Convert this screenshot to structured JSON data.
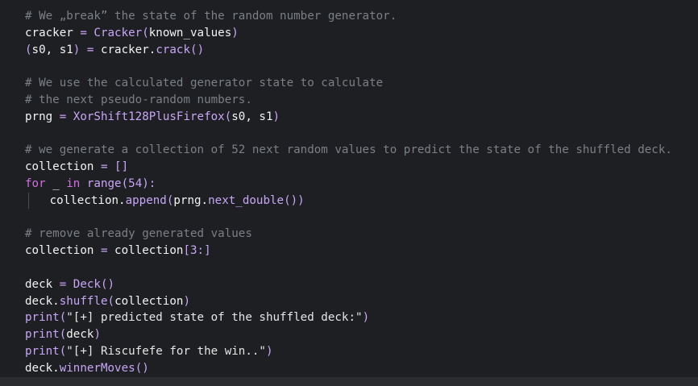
{
  "colors": {
    "background": "#1e1f22",
    "comment": "#7b7f86",
    "keyword": "#cf6fe0",
    "function": "#c8a6f7",
    "text": "#e6e6e6"
  },
  "code": {
    "lines": [
      {
        "tokens": [
          {
            "t": "comment",
            "v": "# We „break” the state of the random number generator."
          }
        ]
      },
      {
        "tokens": [
          {
            "t": "ident",
            "v": "cracker"
          },
          {
            "t": "op",
            "v": " = "
          },
          {
            "t": "fn",
            "v": "Cracker"
          },
          {
            "t": "op",
            "v": "("
          },
          {
            "t": "ident",
            "v": "known_values"
          },
          {
            "t": "op",
            "v": ")"
          }
        ]
      },
      {
        "tokens": [
          {
            "t": "op",
            "v": "("
          },
          {
            "t": "ident",
            "v": "s0, s1"
          },
          {
            "t": "op",
            "v": ")"
          },
          {
            "t": "op",
            "v": " = "
          },
          {
            "t": "ident",
            "v": "cracker."
          },
          {
            "t": "fn",
            "v": "crack"
          },
          {
            "t": "op",
            "v": "()"
          }
        ]
      },
      {
        "tokens": [
          {
            "t": "ident",
            "v": ""
          }
        ]
      },
      {
        "tokens": [
          {
            "t": "comment",
            "v": "# We use the calculated generator state to calculate"
          }
        ]
      },
      {
        "tokens": [
          {
            "t": "comment",
            "v": "# the next pseudo-random numbers."
          }
        ]
      },
      {
        "tokens": [
          {
            "t": "ident",
            "v": "prng"
          },
          {
            "t": "op",
            "v": " = "
          },
          {
            "t": "fn",
            "v": "XorShift128PlusFirefox"
          },
          {
            "t": "op",
            "v": "("
          },
          {
            "t": "ident",
            "v": "s0, s1"
          },
          {
            "t": "op",
            "v": ")"
          }
        ]
      },
      {
        "tokens": [
          {
            "t": "ident",
            "v": ""
          }
        ]
      },
      {
        "tokens": [
          {
            "t": "comment",
            "v": "# we generate a collection of 52 next random values to predict the state of the shuffled deck."
          }
        ]
      },
      {
        "tokens": [
          {
            "t": "ident",
            "v": "collection"
          },
          {
            "t": "op",
            "v": " = "
          },
          {
            "t": "op",
            "v": "[]"
          }
        ]
      },
      {
        "tokens": [
          {
            "t": "kw",
            "v": "for"
          },
          {
            "t": "ident",
            "v": " _ "
          },
          {
            "t": "kw",
            "v": "in"
          },
          {
            "t": "ident",
            "v": " "
          },
          {
            "t": "fn",
            "v": "range"
          },
          {
            "t": "op",
            "v": "("
          },
          {
            "t": "num",
            "v": "54"
          },
          {
            "t": "op",
            "v": "):"
          }
        ]
      },
      {
        "indent": true,
        "tokens": [
          {
            "t": "ident",
            "v": "collection."
          },
          {
            "t": "fn",
            "v": "append"
          },
          {
            "t": "op",
            "v": "("
          },
          {
            "t": "ident",
            "v": "prng."
          },
          {
            "t": "fn",
            "v": "next_double"
          },
          {
            "t": "op",
            "v": "())"
          }
        ]
      },
      {
        "tokens": [
          {
            "t": "ident",
            "v": ""
          }
        ]
      },
      {
        "tokens": [
          {
            "t": "comment",
            "v": "# remove already generated values"
          }
        ]
      },
      {
        "tokens": [
          {
            "t": "ident",
            "v": "collection"
          },
          {
            "t": "op",
            "v": " = "
          },
          {
            "t": "ident",
            "v": "collection"
          },
          {
            "t": "op",
            "v": "["
          },
          {
            "t": "num",
            "v": "3:"
          },
          {
            "t": "op",
            "v": "]"
          }
        ]
      },
      {
        "tokens": [
          {
            "t": "ident",
            "v": ""
          }
        ]
      },
      {
        "tokens": [
          {
            "t": "ident",
            "v": "deck"
          },
          {
            "t": "op",
            "v": " = "
          },
          {
            "t": "fn",
            "v": "Deck"
          },
          {
            "t": "op",
            "v": "()"
          }
        ]
      },
      {
        "tokens": [
          {
            "t": "ident",
            "v": "deck."
          },
          {
            "t": "fn",
            "v": "shuffle"
          },
          {
            "t": "op",
            "v": "("
          },
          {
            "t": "ident",
            "v": "collection"
          },
          {
            "t": "op",
            "v": ")"
          }
        ]
      },
      {
        "tokens": [
          {
            "t": "fn",
            "v": "print"
          },
          {
            "t": "op",
            "v": "("
          },
          {
            "t": "str",
            "v": "\"[+] predicted state of the shuffled deck:\""
          },
          {
            "t": "op",
            "v": ")"
          }
        ]
      },
      {
        "tokens": [
          {
            "t": "fn",
            "v": "print"
          },
          {
            "t": "op",
            "v": "("
          },
          {
            "t": "ident",
            "v": "deck"
          },
          {
            "t": "op",
            "v": ")"
          }
        ]
      },
      {
        "tokens": [
          {
            "t": "fn",
            "v": "print"
          },
          {
            "t": "op",
            "v": "("
          },
          {
            "t": "str",
            "v": "\"[+] Riscufefe for the win..\""
          },
          {
            "t": "op",
            "v": ")"
          }
        ]
      },
      {
        "tokens": [
          {
            "t": "ident",
            "v": "deck."
          },
          {
            "t": "fn",
            "v": "winnerMoves"
          },
          {
            "t": "op",
            "v": "()"
          }
        ]
      }
    ]
  }
}
